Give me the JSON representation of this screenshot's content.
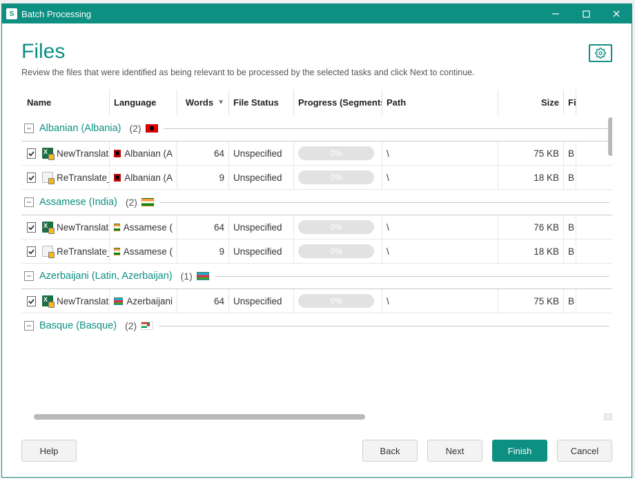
{
  "window": {
    "title": "Batch Processing",
    "app_glyph": "S"
  },
  "page": {
    "heading": "Files",
    "subheading": "Review the files that were identified as being relevant to be processed by the selected tasks and click Next to continue."
  },
  "columns": {
    "name": "Name",
    "language": "Language",
    "words": "Words",
    "file_status": "File Status",
    "progress": "Progress (Segments)",
    "path": "Path",
    "size": "Size",
    "fi": "Fi"
  },
  "groups": [
    {
      "name": "Albanian (Albania)",
      "count": "(2)",
      "flag": "flag-al",
      "rows": [
        {
          "checked": true,
          "fileicon": "xl",
          "filename": "NewTranslat",
          "flag": "flag-al",
          "language": "Albanian (A",
          "words": "64",
          "status": "Unspecified",
          "progress": "0%",
          "path": "\\",
          "size": "75 KB",
          "fi": "B"
        },
        {
          "checked": true,
          "fileicon": "doc",
          "filename": "ReTranslate_",
          "flag": "flag-al",
          "language": "Albanian (A",
          "words": "9",
          "status": "Unspecified",
          "progress": "0%",
          "path": "\\",
          "size": "18 KB",
          "fi": "B"
        }
      ]
    },
    {
      "name": "Assamese (India)",
      "count": "(2)",
      "flag": "flag-in",
      "rows": [
        {
          "checked": true,
          "fileicon": "xl",
          "filename": "NewTranslat",
          "flag": "flag-in",
          "language": "Assamese (",
          "words": "64",
          "status": "Unspecified",
          "progress": "0%",
          "path": "\\",
          "size": "76 KB",
          "fi": "B"
        },
        {
          "checked": true,
          "fileicon": "doc",
          "filename": "ReTranslate_",
          "flag": "flag-in",
          "language": "Assamese (",
          "words": "9",
          "status": "Unspecified",
          "progress": "0%",
          "path": "\\",
          "size": "18 KB",
          "fi": "B"
        }
      ]
    },
    {
      "name": "Azerbaijani (Latin, Azerbaijan)",
      "count": "(1)",
      "flag": "flag-az",
      "rows": [
        {
          "checked": true,
          "fileicon": "xl",
          "filename": "NewTranslat",
          "flag": "flag-az",
          "language": "Azerbaijani",
          "words": "64",
          "status": "Unspecified",
          "progress": "0%",
          "path": "\\",
          "size": "75 KB",
          "fi": "B"
        }
      ]
    },
    {
      "name": "Basque (Basque)",
      "count": "(2)",
      "flag": "flag-eu",
      "rows": []
    }
  ],
  "buttons": {
    "help": "Help",
    "back": "Back",
    "next": "Next",
    "finish": "Finish",
    "cancel": "Cancel"
  }
}
